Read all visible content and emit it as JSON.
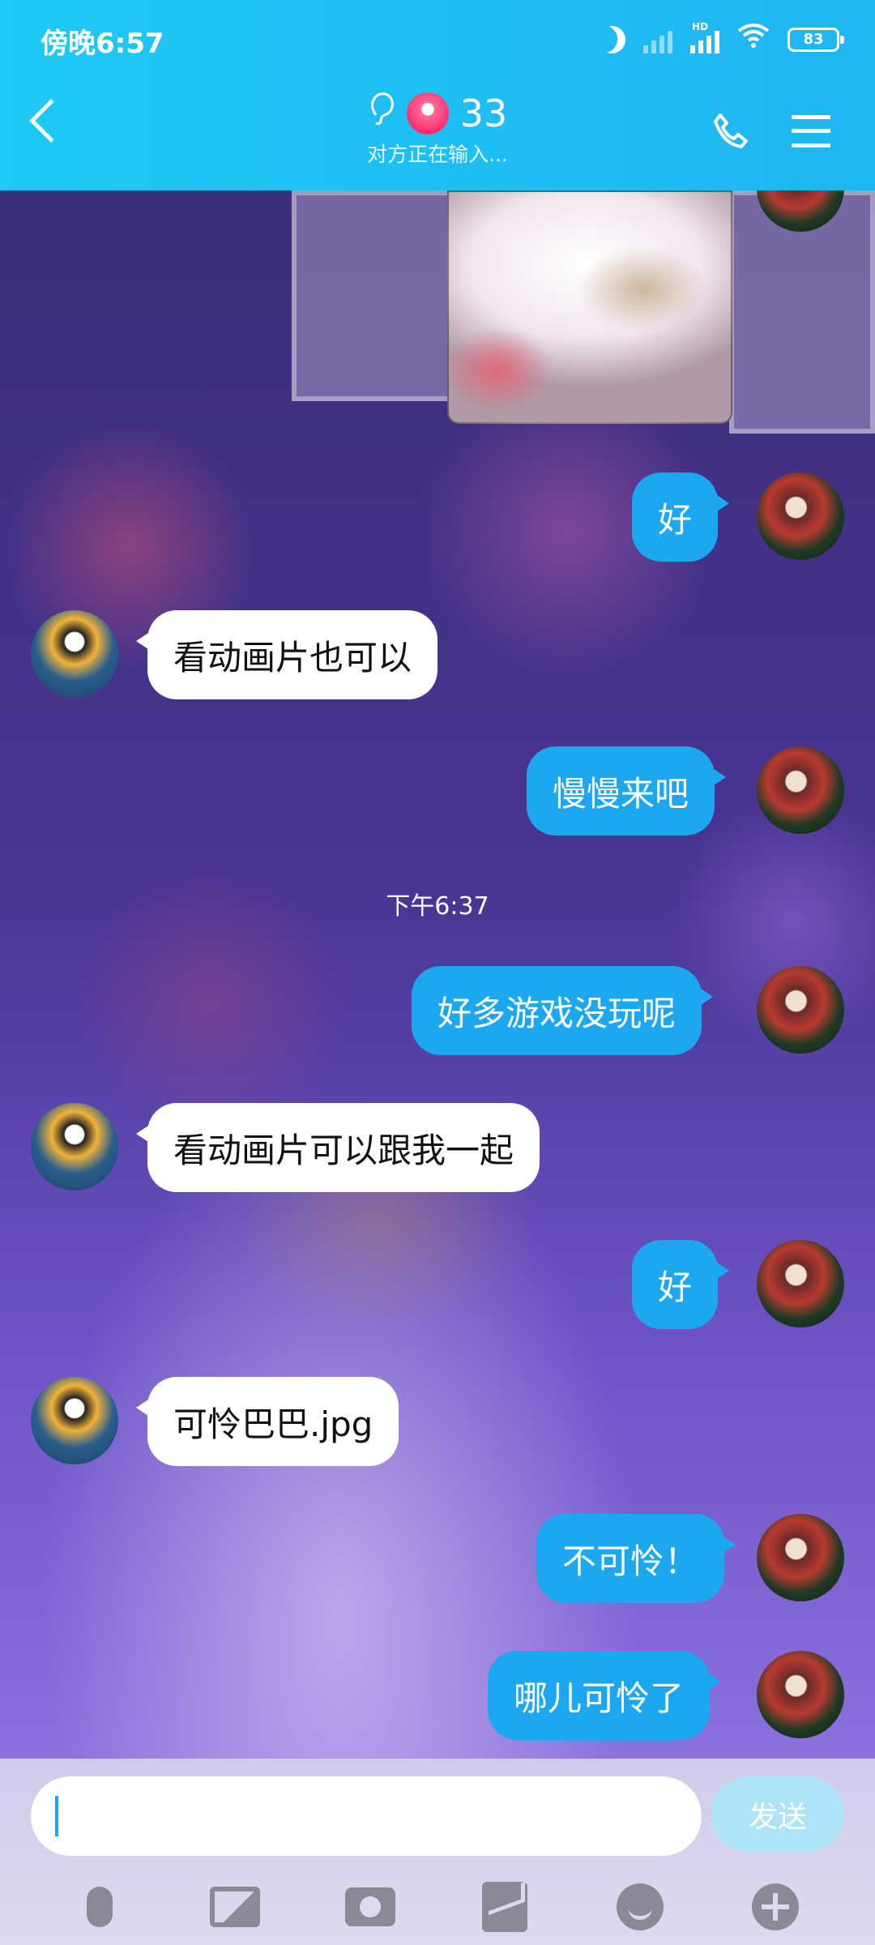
{
  "status_bar": {
    "time": "傍晚6:57",
    "hd": "HD",
    "battery": "83"
  },
  "header": {
    "title": "33",
    "subtitle": "对方正在输入..."
  },
  "timestamp": "下午6:37",
  "messages": [
    {
      "side": "out",
      "text": "好"
    },
    {
      "side": "in",
      "text": "看动画片也可以"
    },
    {
      "side": "out",
      "text": "慢慢来吧"
    },
    {
      "side": "out",
      "text": "好多游戏没玩呢"
    },
    {
      "side": "in",
      "text": "看动画片可以跟我一起"
    },
    {
      "side": "out",
      "text": "好"
    },
    {
      "side": "in",
      "text": "可怜巴巴.jpg"
    },
    {
      "side": "out",
      "text": "不可怜！"
    },
    {
      "side": "out",
      "text": "哪儿可怜了"
    }
  ],
  "input": {
    "value": "",
    "send_label": "发送"
  },
  "toolbar": [
    "mic-icon",
    "image-icon",
    "camera-icon",
    "red-packet-icon",
    "emoji-icon",
    "plus-icon"
  ],
  "colors": {
    "header": "#1fb5f3",
    "outgoing_bubble": "#1ba8f0",
    "incoming_bubble": "#ffffff",
    "send_button": "#aee4f7"
  }
}
